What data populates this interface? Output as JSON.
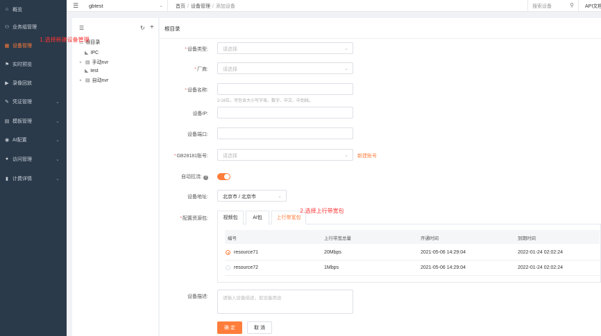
{
  "sidebar": {
    "items": [
      {
        "label": "概览",
        "icon": "dashboard-icon",
        "glyph": "⌂",
        "arrow": ""
      },
      {
        "label": "业务组管理",
        "icon": "group-icon",
        "glyph": "⚇",
        "arrow": ""
      },
      {
        "label": "设备管理",
        "icon": "device-icon",
        "glyph": "▦",
        "arrow": "",
        "active": true
      },
      {
        "label": "实时预览",
        "icon": "flag-icon",
        "glyph": "⚑",
        "arrow": ""
      },
      {
        "label": "录像回放",
        "icon": "video-icon",
        "glyph": "▶",
        "arrow": ""
      },
      {
        "label": "凭证管理",
        "icon": "credential-icon",
        "glyph": "✎",
        "arrow": "⌄"
      },
      {
        "label": "模板管理",
        "icon": "template-icon",
        "glyph": "▤",
        "arrow": "⌄"
      },
      {
        "label": "AI配置",
        "icon": "ai-icon",
        "glyph": "◉",
        "arrow": "⌄"
      },
      {
        "label": "访问管理",
        "icon": "user-icon",
        "glyph": "●",
        "arrow": "⌄"
      },
      {
        "label": "计费详情",
        "icon": "billing-icon",
        "glyph": "▮",
        "arrow": "⌄"
      }
    ]
  },
  "topbar": {
    "menu_icon": "☰",
    "project": "gbtest",
    "project_arrow": "⌄",
    "breadcrumb": [
      "首页",
      "设备管理",
      "添加设备"
    ],
    "breadcrumb_sep": "/",
    "search_placeholder": "搜索设备",
    "search_icon": "⚲",
    "api_doc": "API文档"
  },
  "tree": {
    "menu_icon": "☰",
    "refresh_icon": "↻",
    "add_icon": "+",
    "root_label": "根目录",
    "nodes": [
      {
        "label": "IPC",
        "type": "camera"
      },
      {
        "label": "手动nvr",
        "type": "folder"
      },
      {
        "label": "test",
        "type": "camera"
      },
      {
        "label": "自动nvr",
        "type": "folder"
      }
    ]
  },
  "form": {
    "panel_title": "根目录",
    "required_mark": "*",
    "device_type": {
      "label": "设备类型:",
      "placeholder": "请选择"
    },
    "vendor": {
      "label": "厂商:",
      "placeholder": "请选择"
    },
    "device_name": {
      "label": "设备名称:",
      "placeholder": "",
      "hint": "2-16位，可包含大小写字母、数字、中文、中划线。"
    },
    "device_ip": {
      "label": "设备IP:"
    },
    "device_port": {
      "label": "设备端口:"
    },
    "gb_account": {
      "label": "GB28181账号:",
      "placeholder": "请选择",
      "new_link": "新建账号"
    },
    "auto_stream": {
      "label": "自动拉流:",
      "help": "?",
      "on": true
    },
    "location": {
      "label": "设备地址:",
      "value": "北京市 / 北京市"
    },
    "resource_pack": {
      "label": "配置资源包:"
    },
    "description": {
      "label": "设备描述:",
      "placeholder": "请输入设备描述，如设备用途"
    },
    "confirm": "确 定",
    "cancel": "取 消"
  },
  "tabs": [
    "视频包",
    "AI包",
    "上行带宽包"
  ],
  "table": {
    "headers": [
      "编号",
      "上行带宽总量",
      "开通时间",
      "到期时间"
    ],
    "rows": [
      {
        "id": "resource71",
        "bandwidth": "20Mbps",
        "start": "2021-05-06 14:29:04",
        "end": "2022-01-24 02:02:24",
        "selected": true
      },
      {
        "id": "resource72",
        "bandwidth": "1Mbps",
        "start": "2021-05-06 14:29:04",
        "end": "2022-01-24 02:02:24",
        "selected": false
      }
    ]
  },
  "annotations": {
    "step1": "1.选择新建设备管理",
    "step2": "2.选择上行带宽包"
  },
  "colors": {
    "accent": "#ff7d3a",
    "sidebar_bg": "#2b3a4a",
    "annotation": "#ff3333"
  }
}
